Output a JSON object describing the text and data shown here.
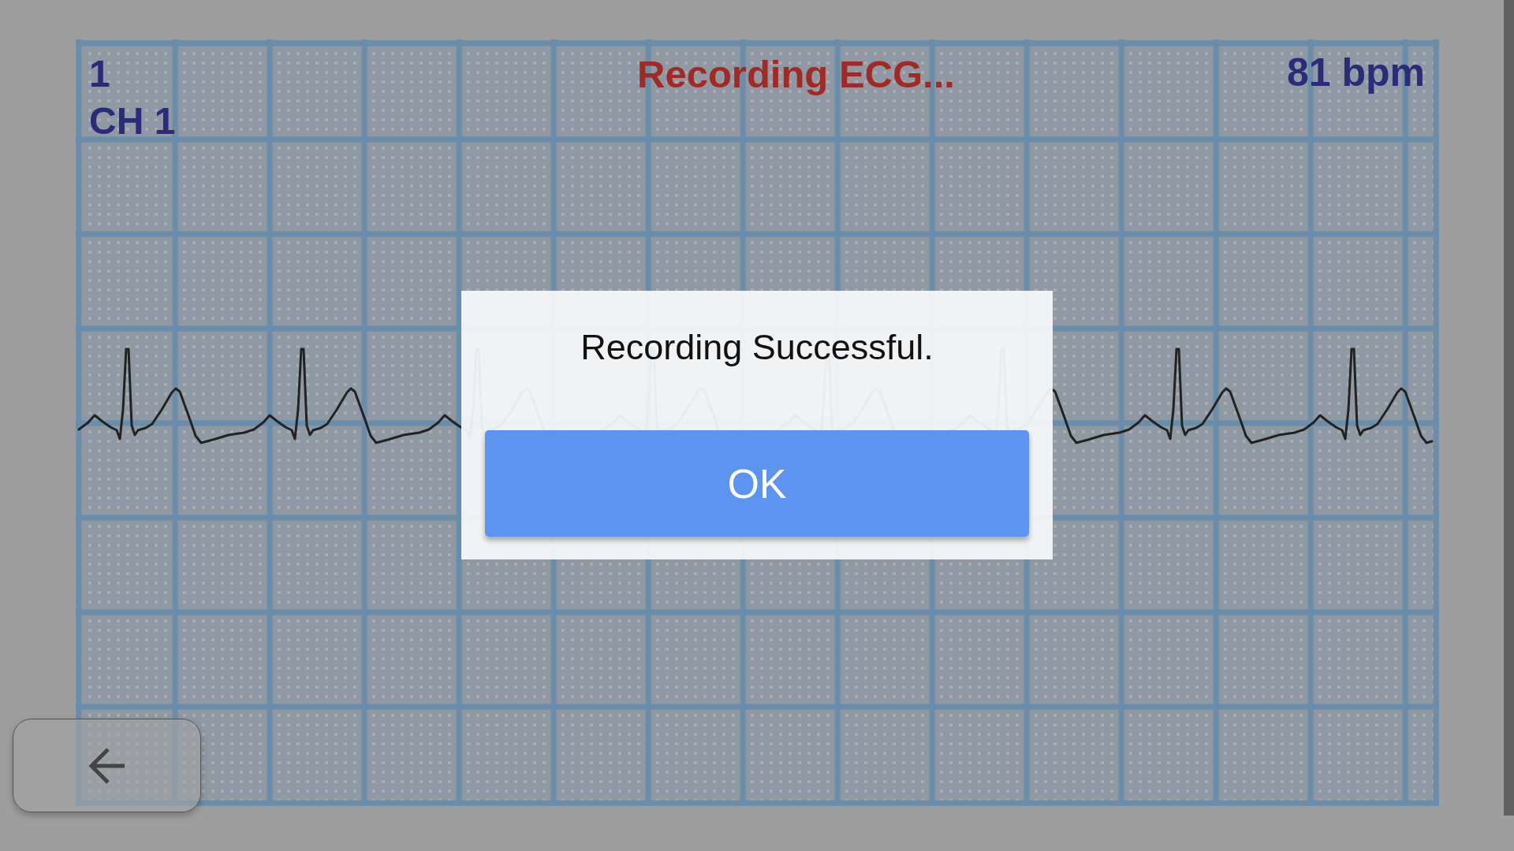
{
  "ecg_panel": {
    "lead": "1",
    "channel": "CH 1",
    "status": "Recording ECG...",
    "heart_rate": "81 bpm"
  },
  "dialog": {
    "message": "Recording Successful.",
    "buttons": [
      "OK"
    ]
  }
}
